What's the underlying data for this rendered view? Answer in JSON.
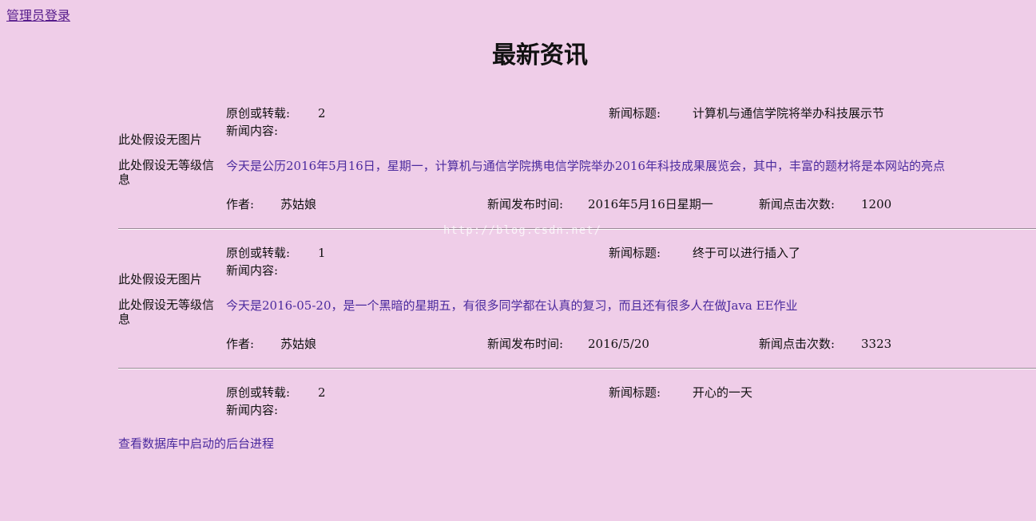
{
  "admin_link": "管理员登录",
  "page_title": "最新资讯",
  "labels": {
    "source": "原创或转载:",
    "title": "新闻标题:",
    "content": "新闻内容:",
    "author": "作者:",
    "publish_time": "新闻发布时间:",
    "clicks": "新闻点击次数:",
    "no_picture": "此处假设无图片",
    "no_level": "此处假设无等级信息"
  },
  "news": [
    {
      "source": "2",
      "title": "计算机与通信学院将举办科技展示节",
      "content": "今天是公历2016年5月16日，星期一，计算机与通信学院携电信学院举办2016年科技成果展览会，其中，丰富的题材将是本网站的亮点",
      "author": "苏姑娘",
      "publish_time": "2016年5月16日星期一",
      "clicks": "1200"
    },
    {
      "source": "1",
      "title": "终于可以进行插入了",
      "content": "今天是2016-05-20，是一个黑暗的星期五，有很多同学都在认真的复习，而且还有很多人在做Java EE作业",
      "author": "苏姑娘",
      "publish_time": "2016/5/20",
      "clicks": "3323"
    },
    {
      "source": "2",
      "title": "开心的一天",
      "content": "查看数据库中启动的后台进程",
      "author": "",
      "publish_time": "",
      "clicks": ""
    }
  ],
  "watermark": "http://blog.csdn.net/"
}
